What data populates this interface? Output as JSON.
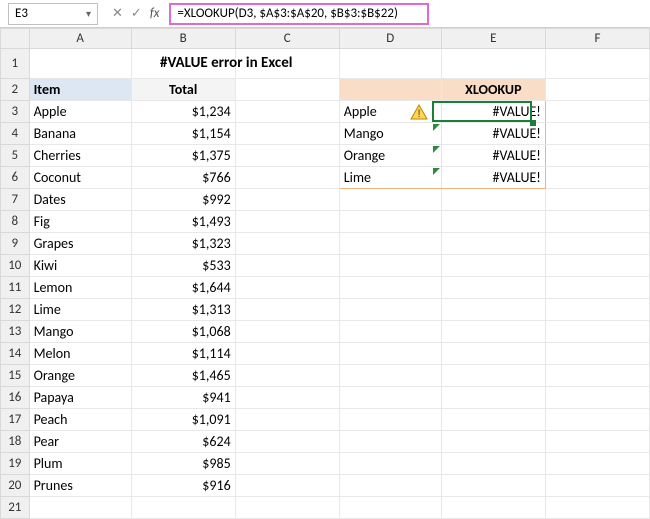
{
  "formula_bar": {
    "name_box": "E3",
    "cancel_sym": "✕",
    "accept_sym": "✓",
    "fx_label": "fx",
    "formula": "=XLOOKUP(D3, $A$3:$A$20, $B$3:$B$22)"
  },
  "columns": [
    "A",
    "B",
    "C",
    "D",
    "E",
    "F"
  ],
  "row_numbers": [
    "1",
    "2",
    "3",
    "4",
    "5",
    "6",
    "7",
    "8",
    "9",
    "10",
    "11",
    "12",
    "13",
    "14",
    "15",
    "16",
    "17",
    "18",
    "19",
    "20",
    "21"
  ],
  "title": "#VALUE error in Excel",
  "headers": {
    "item": "Item",
    "total": "Total",
    "xlookup": "XLOOKUP"
  },
  "items": [
    {
      "name": "Apple",
      "total": "$1,234"
    },
    {
      "name": "Banana",
      "total": "$1,154"
    },
    {
      "name": "Cherries",
      "total": "$1,375"
    },
    {
      "name": "Coconut",
      "total": "$766"
    },
    {
      "name": "Dates",
      "total": "$992"
    },
    {
      "name": "Fig",
      "total": "$1,493"
    },
    {
      "name": "Grapes",
      "total": "$1,323"
    },
    {
      "name": "Kiwi",
      "total": "$533"
    },
    {
      "name": "Lemon",
      "total": "$1,644"
    },
    {
      "name": "Lime",
      "total": "$1,313"
    },
    {
      "name": "Mango",
      "total": "$1,068"
    },
    {
      "name": "Melon",
      "total": "$1,114"
    },
    {
      "name": "Orange",
      "total": "$1,465"
    },
    {
      "name": "Papaya",
      "total": "$941"
    },
    {
      "name": "Peach",
      "total": "$1,091"
    },
    {
      "name": "Pear",
      "total": "$624"
    },
    {
      "name": "Plum",
      "total": "$985"
    },
    {
      "name": "Prunes",
      "total": "$916"
    }
  ],
  "lookup": [
    {
      "key": "Apple",
      "result": "#VALUE!"
    },
    {
      "key": "Mango",
      "result": "#VALUE!"
    },
    {
      "key": "Orange",
      "result": "#VALUE!"
    },
    {
      "key": "Lime",
      "result": "#VALUE!"
    }
  ],
  "chart_data": {
    "type": "table",
    "title": "#VALUE error in Excel",
    "series": [
      {
        "name": "Item",
        "values": [
          "Apple",
          "Banana",
          "Cherries",
          "Coconut",
          "Dates",
          "Fig",
          "Grapes",
          "Kiwi",
          "Lemon",
          "Lime",
          "Mango",
          "Melon",
          "Orange",
          "Papaya",
          "Peach",
          "Pear",
          "Plum",
          "Prunes"
        ]
      },
      {
        "name": "Total",
        "values": [
          1234,
          1154,
          1375,
          766,
          992,
          1493,
          1323,
          533,
          1644,
          1313,
          1068,
          1114,
          1465,
          941,
          1091,
          624,
          985,
          916
        ]
      },
      {
        "name": "XLOOKUP key",
        "values": [
          "Apple",
          "Mango",
          "Orange",
          "Lime"
        ]
      },
      {
        "name": "XLOOKUP result",
        "values": [
          "#VALUE!",
          "#VALUE!",
          "#VALUE!",
          "#VALUE!"
        ]
      }
    ]
  }
}
